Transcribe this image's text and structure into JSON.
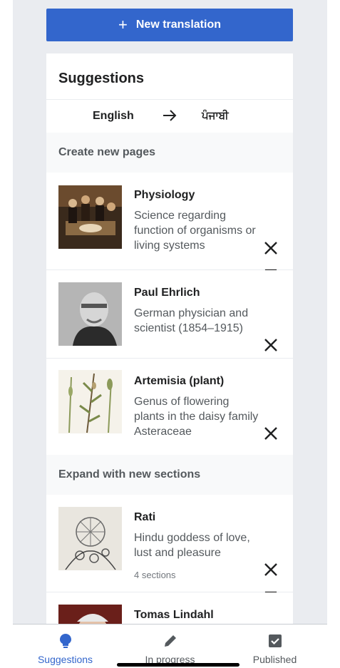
{
  "new_translation": {
    "label": "New translation"
  },
  "suggestions": {
    "title": "Suggestions",
    "source_language": "English",
    "target_language": "ਪੰਜਾਬੀ"
  },
  "sections": {
    "create_header": "Create new pages",
    "expand_header": "Expand with new sections"
  },
  "create_items": [
    {
      "title": "Physiology",
      "description": "Science regarding function of organisms or living systems"
    },
    {
      "title": "Paul Ehrlich",
      "description": "German physician and scientist (1854–1915)"
    },
    {
      "title": "Artemisia (plant)",
      "description": "Genus of flowering plants in the daisy family Asteraceae"
    }
  ],
  "expand_items": [
    {
      "title": "Rati",
      "description": "Hindu goddess of love, lust and pleasure",
      "meta": "4 sections"
    },
    {
      "title": "Tomas Lindahl"
    }
  ],
  "tabs": [
    {
      "label": "Suggestions",
      "icon": "lightbulb-icon",
      "active": true
    },
    {
      "label": "In progress",
      "icon": "pencil-icon",
      "active": false
    },
    {
      "label": "Published",
      "icon": "checkbox-icon",
      "active": false
    }
  ],
  "colors": {
    "accent": "#3366cc",
    "section_bg": "#f8f9fa",
    "page_bg": "#eaecf0"
  }
}
